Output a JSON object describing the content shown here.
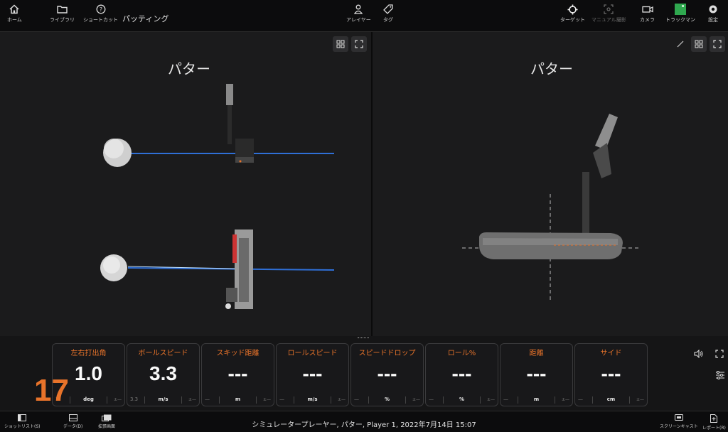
{
  "topbar": {
    "home_label": "ホーム",
    "library_label": "ライブラリ",
    "shortcut_label": "ショートカット",
    "page_title": "パッティング",
    "player_label": "アレイヤー",
    "tag_label": "タグ",
    "target_label": "ターゲット",
    "manual_label": "マニュアル撮影",
    "camera_label": "カメラ",
    "trackman_label": "トラックマン",
    "settings_label": "設定"
  },
  "left_view": {
    "title": "パター"
  },
  "right_view": {
    "title": "パター"
  },
  "metrics": [
    {
      "title": "左右打出角",
      "value": "1.0",
      "unit": "deg",
      "left": "1.",
      "right": "±—"
    },
    {
      "title": "ボールスピード",
      "value": "3.3",
      "unit": "m/s",
      "left": "3.3",
      "right": "±—"
    },
    {
      "title": "スキッド距離",
      "value": "---",
      "unit": "m",
      "left": "—",
      "right": "±—"
    },
    {
      "title": "ロールスピード",
      "value": "---",
      "unit": "m/s",
      "left": "—",
      "right": "±—"
    },
    {
      "title": "スピードドロップ",
      "value": "---",
      "unit": "%",
      "left": "—",
      "right": "±—"
    },
    {
      "title": "ロール%",
      "value": "---",
      "unit": "%",
      "left": "—",
      "right": "±—"
    },
    {
      "title": "距離",
      "value": "---",
      "unit": "m",
      "left": "—",
      "right": "±—"
    },
    {
      "title": "サイド",
      "value": "---",
      "unit": "cm",
      "left": "—",
      "right": "±—"
    }
  ],
  "shot_number": "17",
  "footer": {
    "shotlist_label": "ショットリスト(S)",
    "data_label": "データ(D)",
    "expand_label": "拡張画面",
    "status": "シミュレータープレーヤー, パター, Player 1, 2022年7月14日 15:07",
    "screencast_label": "スクリーンキャスト",
    "report_label": "レポート(R)"
  },
  "colors": {
    "accent": "#e8732a",
    "trackman_green": "#2fa84f",
    "ball_line": "#2f6fd6"
  }
}
